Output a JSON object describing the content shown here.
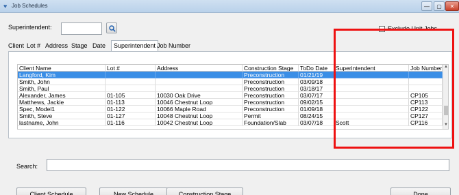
{
  "window": {
    "title": "Job Schedules",
    "controls": {
      "minimize": "—",
      "maximize": "▢",
      "close": "✕"
    }
  },
  "filter": {
    "superintendent_label": "Superintendent:",
    "superintendent_value": "",
    "exclude_unit_jobs_label": "Exclude Unit Jobs",
    "exclude_unit_jobs_checked": false
  },
  "tabs": [
    {
      "label": "Client",
      "active": false
    },
    {
      "label": "Lot #",
      "active": false
    },
    {
      "label": "Address",
      "active": false
    },
    {
      "label": "Stage",
      "active": false
    },
    {
      "label": "Date",
      "active": false
    },
    {
      "label": "Superintendent",
      "active": true
    },
    {
      "label": "Job Number",
      "active": false
    }
  ],
  "table": {
    "columns": [
      "Client Name",
      "Lot #",
      "Address",
      "Construction Stage",
      "ToDo Date",
      "Superintendent",
      "Job Number"
    ],
    "rows": [
      [
        "Langford, Kim",
        "",
        "",
        "Preconstruction",
        "01/21/19",
        "",
        ""
      ],
      [
        "Smith, John",
        "",
        "",
        "Preconstruction",
        "03/09/18",
        "",
        ""
      ],
      [
        "Smith, Paul",
        "",
        "",
        "Preconstruction",
        "03/18/17",
        "",
        ""
      ],
      [
        "Alexander, James",
        "01-105",
        "10030 Oak Drive",
        "Preconstruction",
        "03/07/17",
        "",
        "CP105"
      ],
      [
        "Matthews, Jackie",
        "01-113",
        "10046 Chestnut Loop",
        "Preconstruction",
        "09/02/15",
        "",
        "CP113"
      ],
      [
        "Spec, Model1",
        "01-122",
        "10066 Maple Road",
        "Preconstruction",
        "01/09/18",
        "",
        "CP122"
      ],
      [
        "Smith, Steve",
        "01-127",
        "10048 Chestnut Loop",
        "Permit",
        "08/24/15",
        "",
        "CP127"
      ],
      [
        "lastname, John",
        "01-116",
        "10042 Chestnut Loop",
        "Foundation/Slab",
        "03/07/18",
        "Scott",
        "CP116"
      ]
    ],
    "selected_row": 0
  },
  "search": {
    "label": "Search:",
    "value": ""
  },
  "buttons": {
    "client_schedule": "Client Schedule",
    "new_schedule": "New Schedule",
    "construction_stage": "Construction Stage",
    "done": "Done"
  },
  "colors": {
    "selection": "#3a8ee6",
    "highlight_box": "#ee1111",
    "title_bar": "#c4d8ee"
  }
}
